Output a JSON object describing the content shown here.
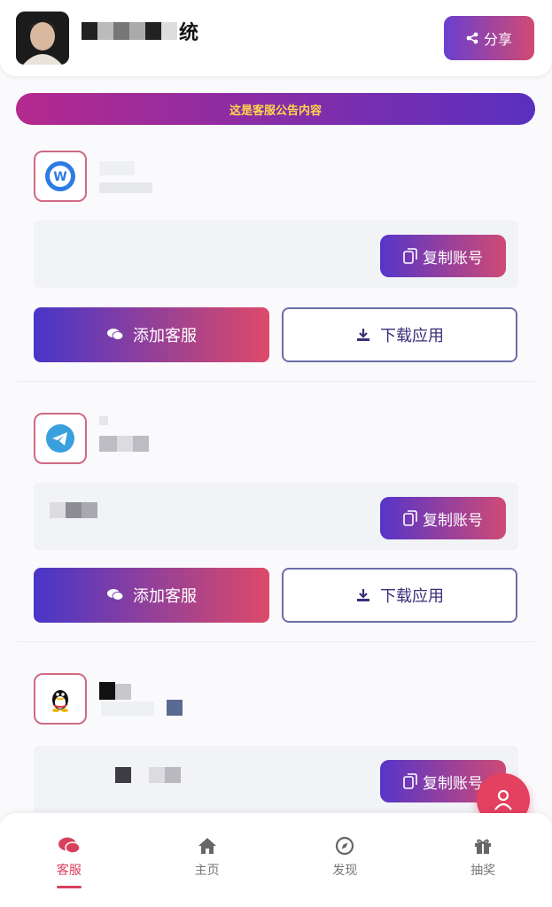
{
  "header": {
    "title_suffix": "统",
    "share_label": "分享"
  },
  "notice": {
    "text": "这是客服公告内容"
  },
  "cards": [
    {
      "logo": "w-chat-logo-icon",
      "copy_label": "复制账号",
      "add_label": "添加客服",
      "download_label": "下载应用"
    },
    {
      "logo": "telegram-logo-icon",
      "copy_label": "复制账号",
      "add_label": "添加客服",
      "download_label": "下载应用"
    },
    {
      "logo": "qq-penguin-logo-icon",
      "copy_label": "复制账号"
    }
  ],
  "nav": {
    "items": [
      {
        "label": "客服",
        "icon": "chat-bubbles-icon",
        "active": true
      },
      {
        "label": "主页",
        "icon": "home-icon",
        "active": false
      },
      {
        "label": "发现",
        "icon": "compass-icon",
        "active": false
      },
      {
        "label": "抽奖",
        "icon": "gift-icon",
        "active": false
      }
    ]
  },
  "colors": {
    "accent": "#d8405c",
    "gradient_start": "#4836c8",
    "gradient_end": "#dd4a6a",
    "notice_text": "#ffd84a"
  }
}
